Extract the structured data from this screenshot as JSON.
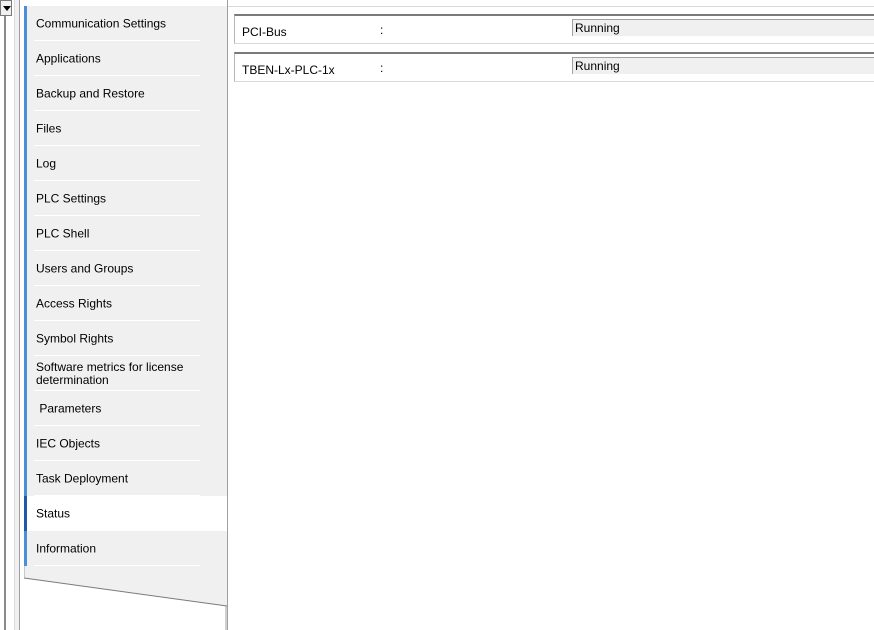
{
  "navigation": {
    "items": [
      {
        "label": "Communication Settings"
      },
      {
        "label": "Applications"
      },
      {
        "label": "Backup and Restore"
      },
      {
        "label": "Files"
      },
      {
        "label": "Log"
      },
      {
        "label": "PLC Settings"
      },
      {
        "label": "PLC Shell"
      },
      {
        "label": "Users and Groups"
      },
      {
        "label": "Access Rights"
      },
      {
        "label": "Symbol Rights"
      },
      {
        "label": "Software metrics for license determination"
      },
      {
        "label": " Parameters"
      },
      {
        "label": "IEC Objects"
      },
      {
        "label": "Task Deployment"
      },
      {
        "label": "Status"
      },
      {
        "label": "Information"
      }
    ],
    "active_label": "Status"
  },
  "status": {
    "rows": [
      {
        "name": "PCI-Bus",
        "separator": ":",
        "value": "Running"
      },
      {
        "name": "TBEN-Lx-PLC-1x",
        "separator": ":",
        "value": "Running"
      }
    ]
  },
  "colors": {
    "accent": "#4a90d9",
    "active_accent": "#1e5aa8",
    "panel_bg": "#f0f0f0"
  }
}
